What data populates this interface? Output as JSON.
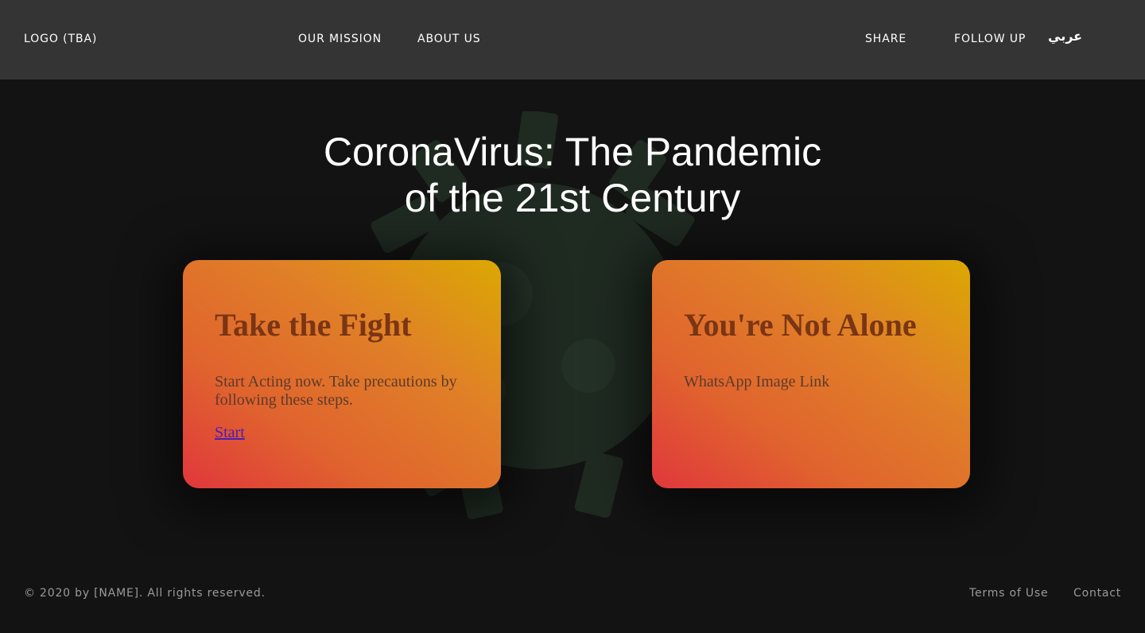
{
  "header": {
    "logo": "LOGO (TBA)",
    "nav_left": [
      "OUR MISSION",
      "ABOUT US"
    ],
    "nav_right": [
      "SHARE",
      "FOLLOW UP"
    ],
    "language": "عربي"
  },
  "hero": {
    "title_line1": "CoronaVirus: The Pandemic",
    "title_line2": "of the 21st Century",
    "background_icon": "virus-icon"
  },
  "cards": [
    {
      "title": "Take the Fight",
      "text": "Start Acting now. Take precautions by following these steps.",
      "link": "Start"
    },
    {
      "title": "You're Not Alone",
      "text": "WhatsApp Image Link"
    }
  ],
  "footer": {
    "copyright": "© 2020 by [NAME]. All rights reserved.",
    "links": [
      "Terms of Use",
      "Contact"
    ]
  },
  "colors": {
    "header_bg": "#343434",
    "page_bg": "#131313",
    "card_gradient_start": "#e0373c",
    "card_gradient_end": "#dba803",
    "card_title": "#7a3514",
    "link": "#4b1fb2"
  }
}
